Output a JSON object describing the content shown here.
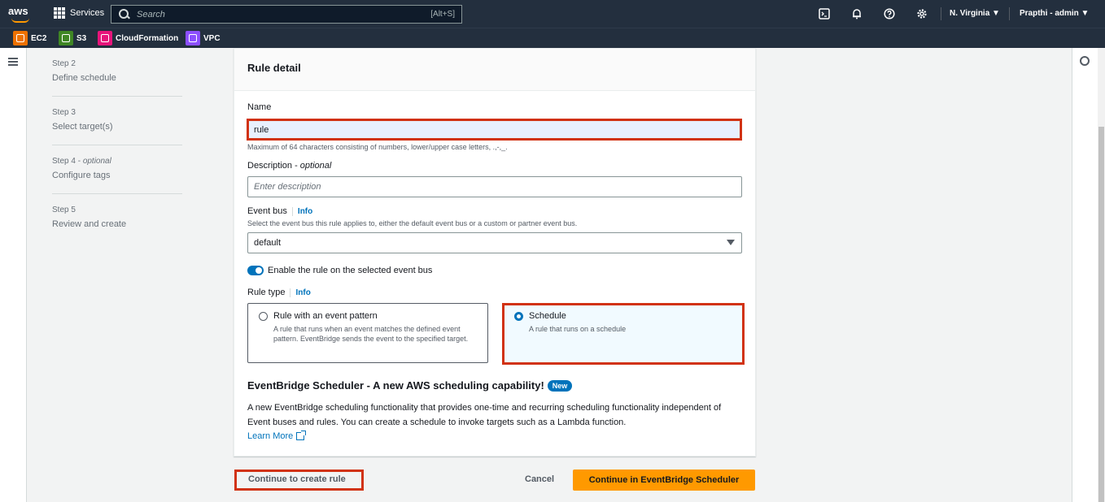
{
  "topnav": {
    "logo": "aws",
    "services_label": "Services",
    "search_placeholder": "Search",
    "search_shortcut": "[Alt+S]",
    "region": "N. Virginia ▼",
    "account": "Prapthi - admin ▼"
  },
  "favorites": [
    {
      "label": "EC2",
      "color": "#ed7100"
    },
    {
      "label": "S3",
      "color": "#3f8624"
    },
    {
      "label": "CloudFormation",
      "color": "#e7157b"
    },
    {
      "label": "VPC",
      "color": "#8c4fff"
    }
  ],
  "steps": [
    {
      "num": "Step 2",
      "optional": "",
      "title": "Define schedule"
    },
    {
      "num": "Step 3",
      "optional": "",
      "title": "Select target(s)"
    },
    {
      "num": "Step 4 - ",
      "optional": "optional",
      "title": "Configure tags"
    },
    {
      "num": "Step 5",
      "optional": "",
      "title": "Review and create"
    }
  ],
  "card": {
    "title": "Rule detail",
    "name_label": "Name",
    "name_value": "rule",
    "name_hint": "Maximum of 64 characters consisting of numbers, lower/upper case letters, .,-,_.",
    "description_label": "Description - ",
    "description_optional": "optional",
    "description_placeholder": "Enter description",
    "event_bus_label": "Event bus",
    "info": "Info",
    "event_bus_hint": "Select the event bus this rule applies to, either the default event bus or a custom or partner event bus.",
    "event_bus_value": "default",
    "toggle_label": "Enable the rule on the selected event bus",
    "rule_type_label": "Rule type",
    "tile_pattern_title": "Rule with an event pattern",
    "tile_pattern_desc": "A rule that runs when an event matches the defined event pattern. EventBridge sends the event to the specified target.",
    "tile_schedule_title": "Schedule",
    "tile_schedule_desc": "A rule that runs on a schedule",
    "promo_title": "EventBridge Scheduler - A new AWS scheduling capability!",
    "promo_badge": "New",
    "promo_text": "A new EventBridge scheduling functionality that provides one-time and recurring scheduling functionality independent of Event buses and rules. You can create a schedule to invoke targets such as a Lambda function.",
    "learn_more": "Learn More"
  },
  "actions": {
    "continue_rule": "Continue to create rule",
    "cancel": "Cancel",
    "continue_scheduler": "Continue in EventBridge Scheduler"
  }
}
